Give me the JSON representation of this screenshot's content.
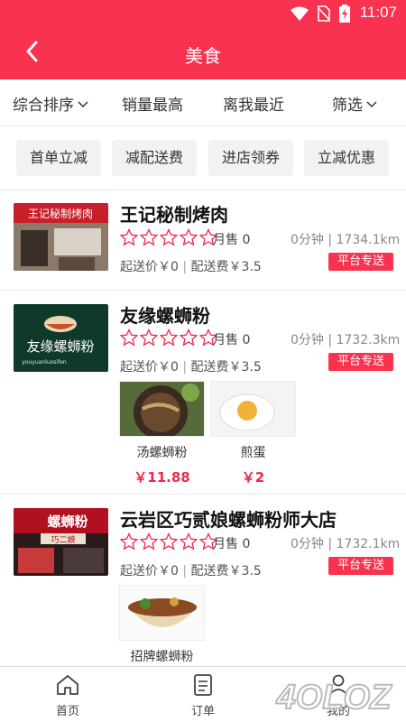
{
  "status_bar": {
    "time": "11:07",
    "icons": [
      "wifi-icon",
      "sim-off-icon",
      "battery-charging-icon"
    ]
  },
  "header": {
    "title": "美食",
    "back_icon": "chevron-left-icon"
  },
  "sort_bar": {
    "items": [
      {
        "label": "综合排序",
        "has_dropdown": true
      },
      {
        "label": "销量最高",
        "has_dropdown": false
      },
      {
        "label": "离我最近",
        "has_dropdown": false
      },
      {
        "label": "筛选",
        "has_dropdown": true
      }
    ]
  },
  "promo_chips": [
    "首单立减",
    "减配送费",
    "进店领券",
    "立减优惠"
  ],
  "shops": [
    {
      "name": "王记秘制烤肉",
      "rating": 0,
      "monthly_sales": "月售 0",
      "distance": "0分钟 | 1734.1km",
      "min_order": "起送价￥0",
      "delivery_fee": "配送费￥3.5",
      "badge": "平台专送",
      "sign_text": "王记秘制烤肉",
      "dishes": []
    },
    {
      "name": "友缘螺蛳粉",
      "rating": 0,
      "monthly_sales": "月售 0",
      "distance": "0分钟 | 1732.3km",
      "min_order": "起送价￥0",
      "delivery_fee": "配送费￥3.5",
      "badge": "平台专送",
      "logo_text": "友缘螺蛳粉",
      "logo_subtext": "youyuanluosifen",
      "dishes": [
        {
          "name": "汤螺蛳粉",
          "price": "￥11.88"
        },
        {
          "name": "煎蛋",
          "price": "￥2"
        }
      ]
    },
    {
      "name": "云岩区巧贰娘螺蛳粉师大店",
      "rating": 0,
      "monthly_sales": "月售 0",
      "distance": "0分钟 | 1732.1km",
      "min_order": "起送价￥0",
      "delivery_fee": "配送费￥3.5",
      "badge": "平台专送",
      "sign_text": "螺蛳粉",
      "sign_subtext": "巧二娘",
      "dishes": [
        {
          "name": "招牌螺蛳粉",
          "price": ""
        }
      ]
    }
  ],
  "tab_bar": {
    "tabs": [
      {
        "label": "首页",
        "icon": "home-icon"
      },
      {
        "label": "订单",
        "icon": "order-list-icon"
      },
      {
        "label": "我的",
        "icon": "user-icon"
      }
    ]
  },
  "watermark": "4OLOZ",
  "colors": {
    "primary": "#f8324f",
    "price": "#f0284a",
    "chip_bg": "#f2f2f2"
  }
}
